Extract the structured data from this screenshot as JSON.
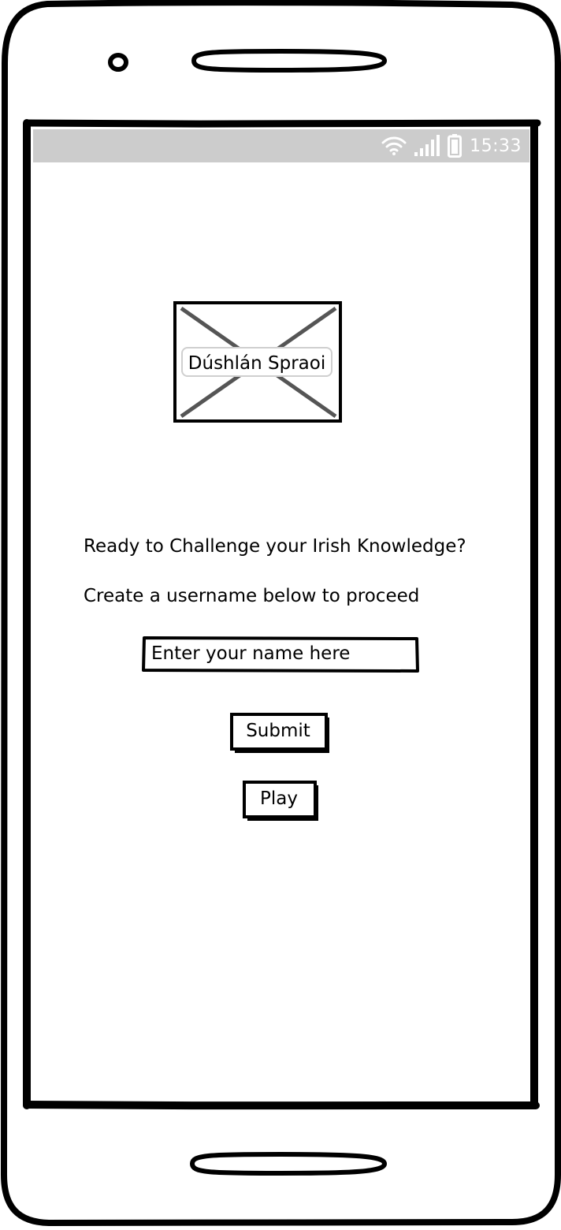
{
  "status_bar": {
    "time": "15:33",
    "icons": [
      "wifi-icon",
      "signal-icon",
      "battery-icon"
    ]
  },
  "logo": {
    "label": "Dúshlán Spraoi",
    "icon": "image-placeholder-icon"
  },
  "main": {
    "heading": "Ready to Challenge your Irish Knowledge?",
    "instruction": "Create a username below to proceed"
  },
  "username_input": {
    "value": "",
    "placeholder": "Enter your name here"
  },
  "buttons": {
    "submit_label": "Submit",
    "play_label": "Play"
  },
  "colors": {
    "status_bar_bg": "#cccccc",
    "outline": "#000000",
    "placeholder_cross": "#555555"
  }
}
